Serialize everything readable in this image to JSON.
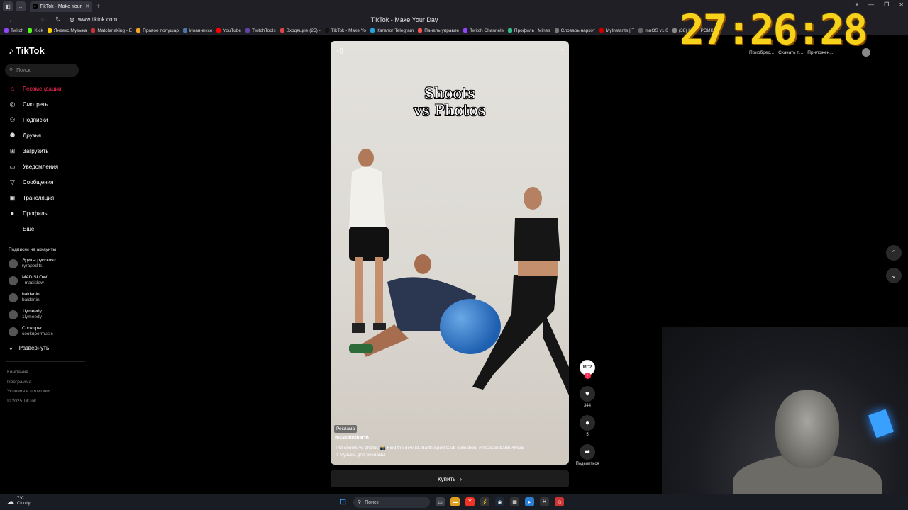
{
  "browser": {
    "tab_title": "TikTok - Make Your Day",
    "url": "www.tiktok.com",
    "page_title": "TikTok - Make Your Day",
    "bookmarks": [
      "Twitch",
      "Kick",
      "Яндекс Музыка",
      "Matchmaking - E",
      "Правое полушар",
      "Иоанниксе",
      "YouTube",
      "TwitchTools",
      "Входящие (25) - ",
      "TikTok - Make Yo",
      "Каталог Telegram",
      "Панель управле",
      "Twitch Channels",
      "Профиль | Mines",
      "Словарь наркот",
      "MyInstants | T",
      "muOS v1.0",
      "(38) НАСТРОЙКА V"
    ],
    "extensions": [
      "Приобрес...",
      "Скачать п...",
      "Приложен..."
    ]
  },
  "clock": "27:26:28",
  "sidebar": {
    "logo": "TikTok",
    "search_placeholder": "Поиск",
    "menu": [
      {
        "label": "Рекомендации",
        "icon": "home-icon",
        "glyph": "⌂"
      },
      {
        "label": "Смотреть",
        "icon": "compass-icon",
        "glyph": "◎"
      },
      {
        "label": "Подписки",
        "icon": "following-icon",
        "glyph": "⚇"
      },
      {
        "label": "Друзья",
        "icon": "friends-icon",
        "glyph": "⚉"
      },
      {
        "label": "Загрузить",
        "icon": "upload-icon",
        "glyph": "⊞"
      },
      {
        "label": "Уведомления",
        "icon": "inbox-icon",
        "glyph": "▭"
      },
      {
        "label": "Сообщения",
        "icon": "messages-icon",
        "glyph": "▽"
      },
      {
        "label": "Трансляция",
        "icon": "live-icon",
        "glyph": "▣"
      },
      {
        "label": "Профиль",
        "icon": "profile-icon",
        "glyph": "●"
      },
      {
        "label": "Еще",
        "icon": "more-icon",
        "glyph": "···"
      }
    ],
    "following_title": "Подписки на аккаунты",
    "accounts": [
      {
        "name": "Эдиты русскояз...",
        "handle": "ryrapedits"
      },
      {
        "name": "MADISLOW",
        "handle": "_madislow_"
      },
      {
        "name": "baldanini",
        "handle": "baldanini"
      },
      {
        "name": "1lymeedy",
        "handle": "1lymeedy"
      },
      {
        "name": "Cookuper",
        "handle": "cookupermusic"
      }
    ],
    "expand_label": "Развернуть",
    "footer": [
      "Компания",
      "Программа",
      "Условия и политики",
      "© 2025 TikTok"
    ]
  },
  "video": {
    "title_line1": "Shoots",
    "title_line2": "vs  Photos",
    "ad_label": "Реклама",
    "author": "mc2saintbarth",
    "description": "The shoots vs photos 📸   Find the new St. Barth Sport Club collection.  #mc2saintbarth  #fw25",
    "music": "♫ Музыка для рекламы",
    "likes": "344",
    "comments": "5",
    "share_label": "Поделиться",
    "avatar_text": "MC2",
    "buy_label": "Купить"
  },
  "taskbar": {
    "weather_temp": "7°C",
    "weather_desc": "Cloudy",
    "search_label": "Поиск"
  }
}
